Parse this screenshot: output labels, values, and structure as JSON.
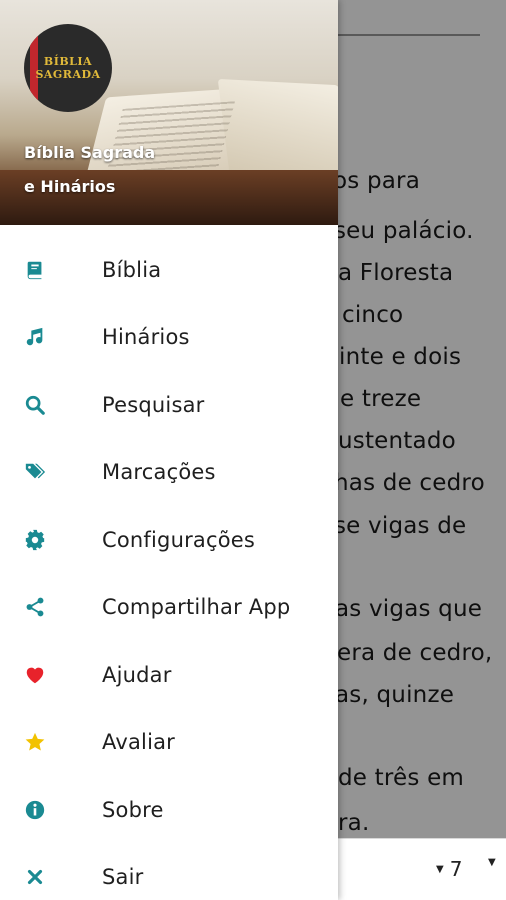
{
  "header": {
    "logo_line1": "BÍBLIA",
    "logo_line2": "SAGRADA",
    "title_line1": "Bíblia Sagrada",
    "title_line2": "e Hinários"
  },
  "menu": [
    {
      "label": "Bíblia",
      "icon": "book-icon",
      "color": "#1a8a92"
    },
    {
      "label": "Hinários",
      "icon": "music-note-icon",
      "color": "#1a8a92"
    },
    {
      "label": "Pesquisar",
      "icon": "search-icon",
      "color": "#1a8a92"
    },
    {
      "label": "Marcações",
      "icon": "tags-icon",
      "color": "#1a8a92"
    },
    {
      "label": "Configurações",
      "icon": "gear-icon",
      "color": "#1a8a92"
    },
    {
      "label": "Compartilhar App",
      "icon": "share-icon",
      "color": "#1a8a92"
    },
    {
      "label": "Ajudar",
      "icon": "heart-icon",
      "color": "#e8222b"
    },
    {
      "label": "Avaliar",
      "icon": "star-icon",
      "color": "#f2c200"
    },
    {
      "label": "Sobre",
      "icon": "info-icon",
      "color": "#1a8a92"
    },
    {
      "label": "Sair",
      "icon": "close-icon",
      "color": "#1a8a92"
    }
  ],
  "background_text": {
    "lines": [
      "os para",
      "seu palácio.",
      "a Floresta",
      "cinco",
      "inte e dois",
      "e treze",
      "ustentado",
      "has de cedro",
      "se vigas de",
      "",
      "as vigas que",
      "era de cedro,",
      "as, quinze",
      "",
      "de três em",
      "ra."
    ]
  },
  "bottom_nav": {
    "chapter": "7"
  },
  "colors": {
    "accent": "#1a8a92",
    "heart": "#e8222b",
    "star": "#f2c200"
  }
}
